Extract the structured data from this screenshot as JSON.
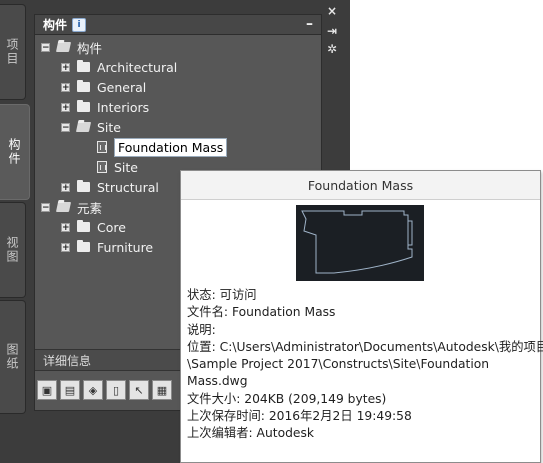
{
  "palette": {
    "title": "构件",
    "info_badge": "i",
    "minimize_label": "–",
    "details_label": "详细信息"
  },
  "side_tabs": [
    "项目",
    "构件",
    "视图",
    "图纸"
  ],
  "window_controls": {
    "close": "×",
    "pin": "⇥",
    "settings": "✲"
  },
  "tree": {
    "root": "构件",
    "categories": [
      "Architectural",
      "General",
      "Interiors",
      "Site",
      "Structural"
    ],
    "site_children": [
      "Foundation Mass",
      "Site"
    ],
    "elements_root": "元素",
    "elements_children": [
      "Core",
      "Furniture"
    ],
    "selected": "Foundation Mass"
  },
  "tooltip": {
    "title": "Foundation Mass",
    "lines": [
      "状态: 可访问",
      "文件名: Foundation Mass",
      "说明:",
      "位置: C:\\Users\\Administrator\\Documents\\Autodesk\\我的项目",
      "\\Sample Project 2017\\Constructs\\Site\\Foundation",
      "Mass.dwg",
      "文件大小: 204KB (209,149 bytes)",
      "上次保存时间: 2016年2月2日  19:49:58",
      "上次编辑者: Autodesk"
    ]
  }
}
